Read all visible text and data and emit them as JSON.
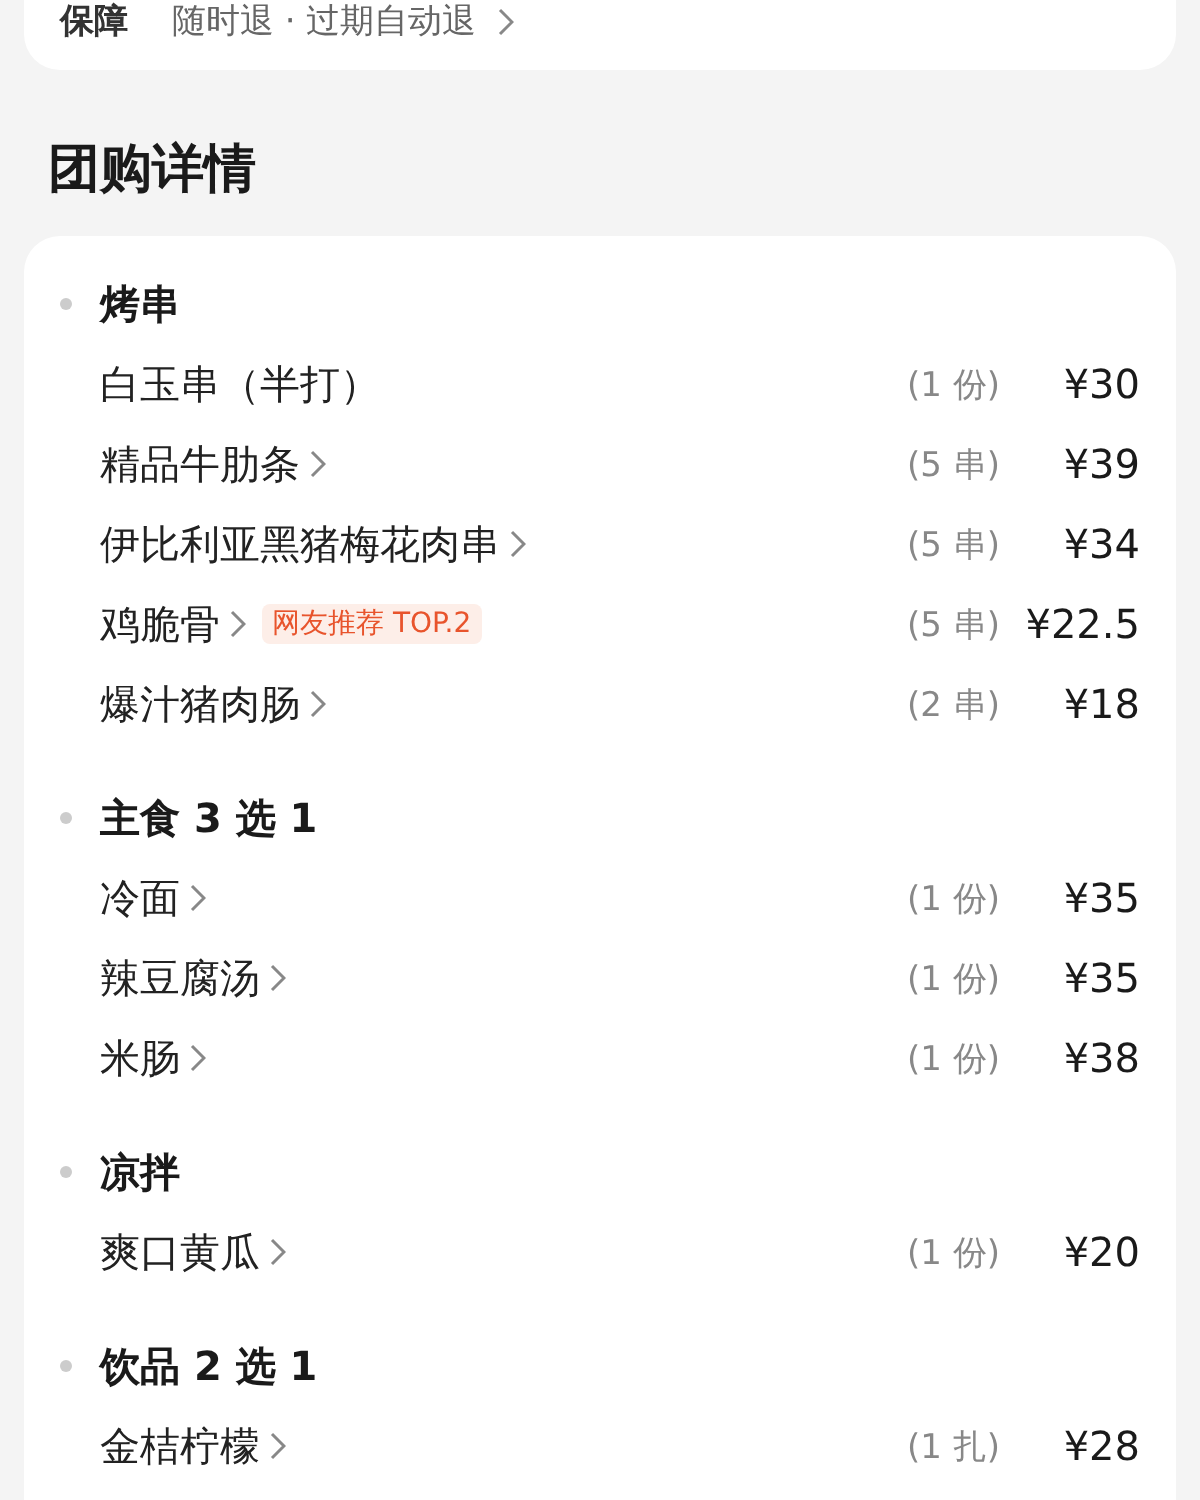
{
  "guarantee": {
    "label": "保障",
    "value": "随时退 · 过期自动退",
    "has_arrow": true
  },
  "section_title": "团购详情",
  "groups": [
    {
      "title": "烤串",
      "items": [
        {
          "name": "白玉串（半打）",
          "has_arrow": false,
          "quantity": "(1 份)",
          "price": "¥30"
        },
        {
          "name": "精品牛肋条",
          "has_arrow": true,
          "quantity": "(5 串)",
          "price": "¥39"
        },
        {
          "name": "伊比利亚黑猪梅花肉串",
          "has_arrow": true,
          "quantity": "(5 串)",
          "price": "¥34"
        },
        {
          "name": "鸡脆骨",
          "has_arrow": true,
          "tag": "网友推荐 TOP.2",
          "quantity": "(5 串)",
          "price": "¥22.5"
        },
        {
          "name": "爆汁猪肉肠",
          "has_arrow": true,
          "quantity": "(2 串)",
          "price": "¥18"
        }
      ]
    },
    {
      "title": "主食 3 选 1",
      "items": [
        {
          "name": "冷面",
          "has_arrow": true,
          "quantity": "(1 份)",
          "price": "¥35"
        },
        {
          "name": "辣豆腐汤",
          "has_arrow": true,
          "quantity": "(1 份)",
          "price": "¥35"
        },
        {
          "name": "米肠",
          "has_arrow": true,
          "quantity": "(1 份)",
          "price": "¥38"
        }
      ]
    },
    {
      "title": "凉拌",
      "items": [
        {
          "name": "爽口黄瓜",
          "has_arrow": true,
          "quantity": "(1 份)",
          "price": "¥20"
        }
      ]
    },
    {
      "title": "饮品 2 选 1",
      "items": [
        {
          "name": "金桔柠檬",
          "has_arrow": true,
          "quantity": "(1 扎)",
          "price": "¥28"
        }
      ]
    }
  ]
}
